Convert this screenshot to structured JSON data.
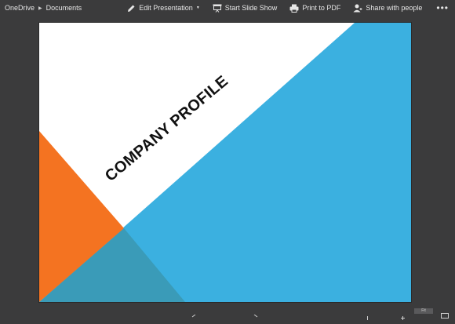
{
  "breadcrumb": {
    "root": "OneDrive",
    "folder": "Documents"
  },
  "toolbar": {
    "edit_label": "Edit Presentation",
    "slideshow_label": "Start Slide Show",
    "pdf_label": "Print to PDF",
    "share_label": "Share with people",
    "more_label": "•••"
  },
  "slide": {
    "title": "COMPANY PROFILE",
    "colors": {
      "blue": "#3bb0e0",
      "orange": "#f47321",
      "overlap": "#3a9bb8",
      "white": "#ffffff"
    }
  },
  "footer": {
    "fit_label": "Fit"
  }
}
